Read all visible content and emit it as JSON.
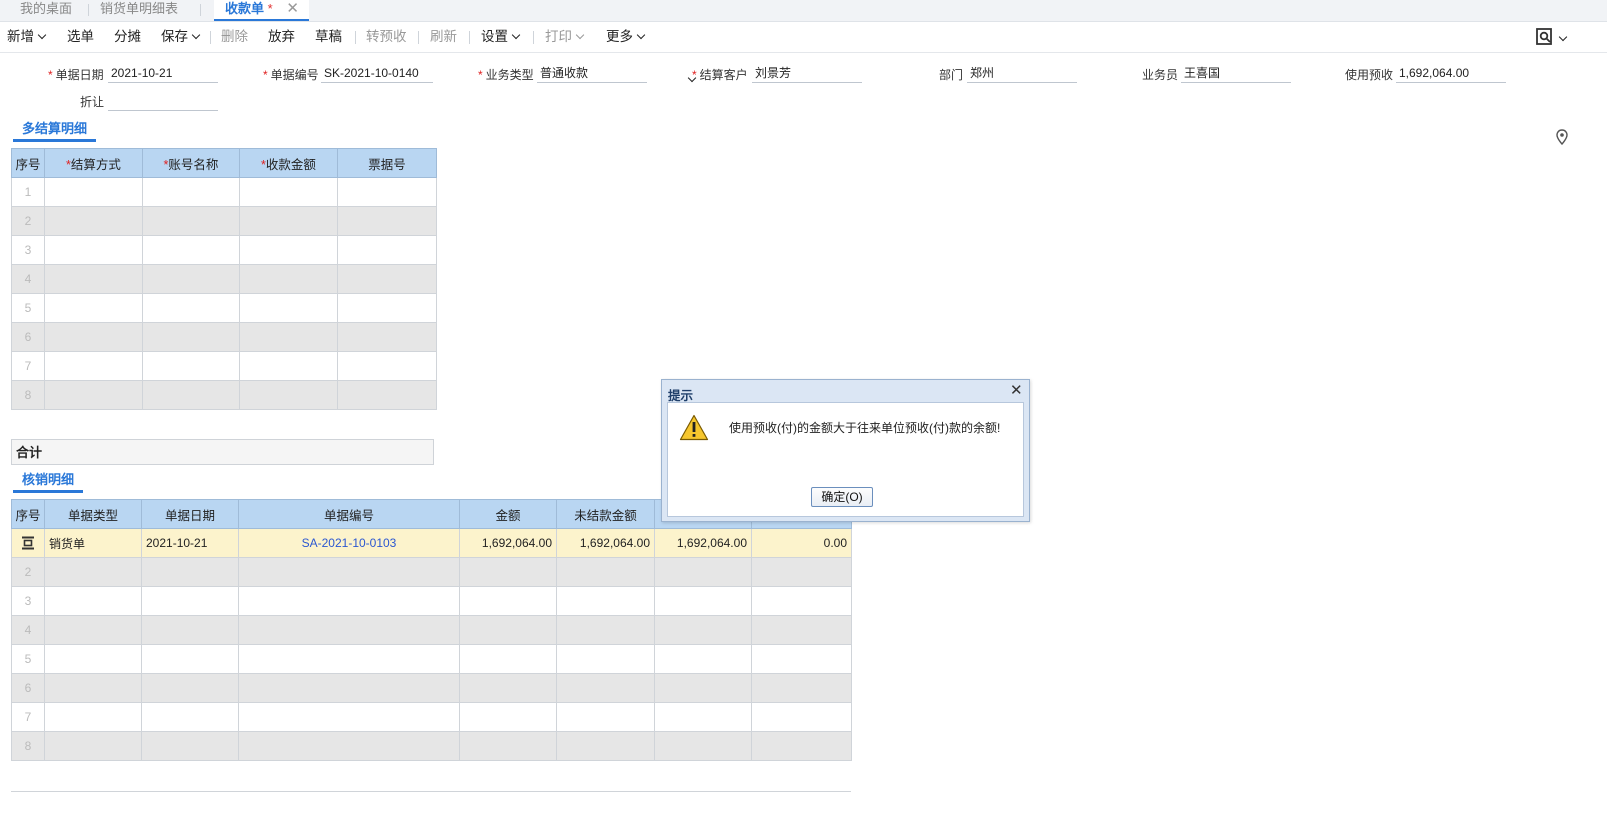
{
  "tabs": [
    {
      "label": "我的桌面"
    },
    {
      "label": "销货单明细表"
    },
    {
      "label": "收款单",
      "modified": "*"
    }
  ],
  "toolbar": {
    "items": [
      "新增",
      "选单",
      "分摊",
      "保存",
      "删除",
      "放弃",
      "草稿",
      "转预收",
      "刷新",
      "设置",
      "打印",
      "更多"
    ]
  },
  "form": {
    "date_label": "单据日期",
    "date_value": "2021-10-21",
    "number_label": "单据编号",
    "number_value": "SK-2021-10-0140",
    "biztype_label": "业务类型",
    "biztype_value": "普通收款",
    "customer_label": "结算客户",
    "customer_value": "刘景芳",
    "dept_label": "部门",
    "dept_value": "郑州",
    "salesman_label": "业务员",
    "salesman_value": "王喜国",
    "prepay_label": "使用预收",
    "prepay_value": "1,692,064.00",
    "discount_label": "折让",
    "discount_value": "",
    "required_mark": "*"
  },
  "settlement": {
    "title": "多结算明细",
    "headers": [
      "序号",
      "结算方式",
      "账号名称",
      "收款金额",
      "票据号"
    ],
    "rows": [
      "1",
      "2",
      "3",
      "4",
      "5",
      "6",
      "7",
      "8"
    ]
  },
  "total": {
    "label": "合计"
  },
  "writeoff": {
    "title": "核销明细",
    "headers": [
      "序号",
      "单据类型",
      "单据日期",
      "单据编号",
      "金额",
      "未结款金额",
      "",
      ""
    ],
    "first_row": {
      "type": "销货单",
      "date": "2021-10-21",
      "number": "SA-2021-10-0103",
      "amount": "1,692,064.00",
      "unsettled": "1,692,064.00",
      "col7": "1,692,064.00",
      "col8": "0.00"
    },
    "rows": [
      "2",
      "3",
      "4",
      "5",
      "6",
      "7",
      "8"
    ]
  },
  "dialog": {
    "title": "提示",
    "message": "使用预收(付)的金额大于往来单位预收(付)款的余额!",
    "ok_label": "确定(O)"
  }
}
